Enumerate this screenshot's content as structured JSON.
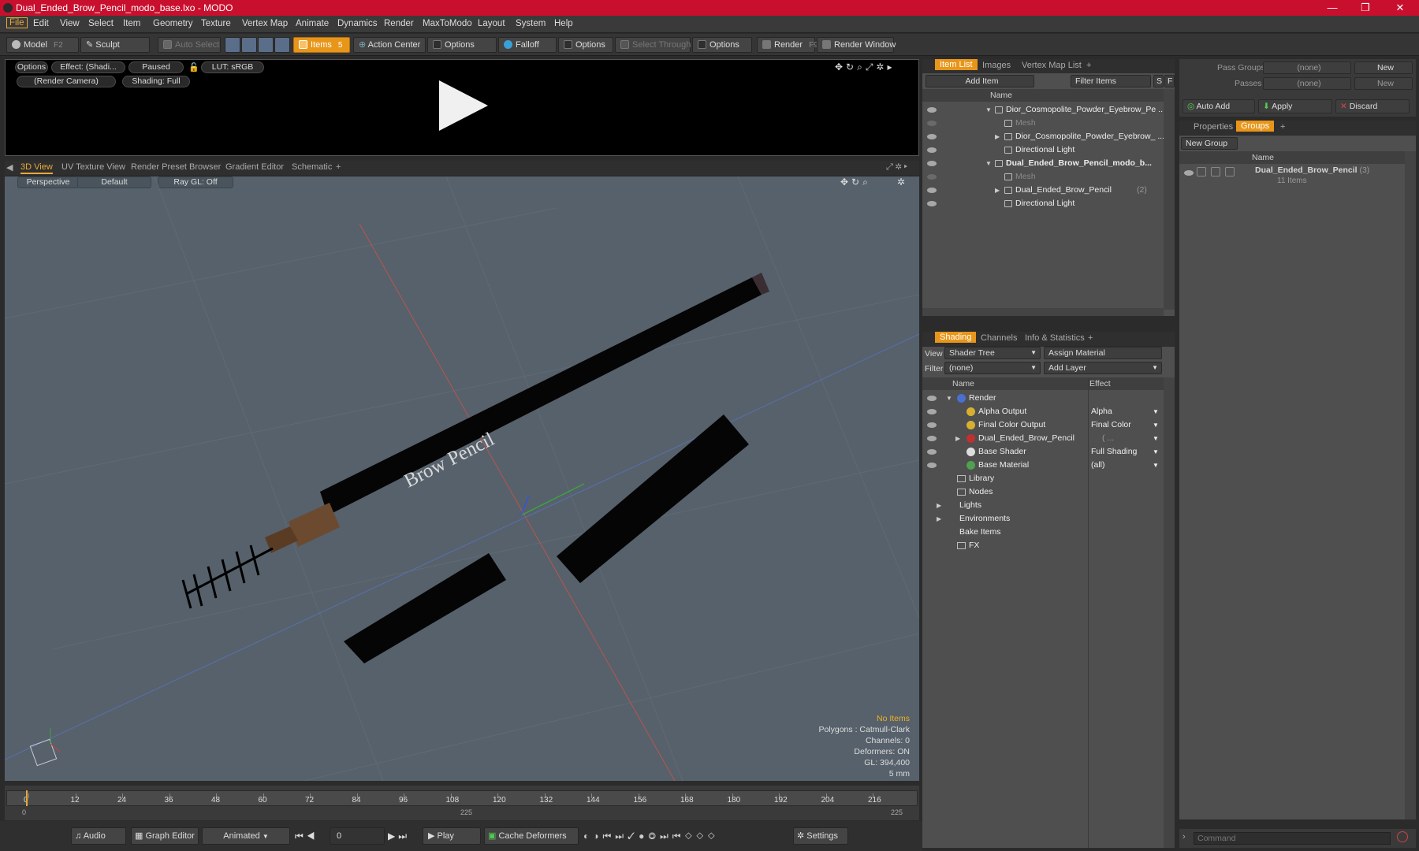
{
  "window": {
    "title": "Dual_Ended_Brow_Pencil_modo_base.lxo - MODO"
  },
  "menu": [
    "File",
    "Edit",
    "View",
    "Select",
    "Item",
    "Geometry",
    "Texture",
    "Vertex Map",
    "Animate",
    "Dynamics",
    "Render",
    "MaxToModo",
    "Layout",
    "System",
    "Help"
  ],
  "toolbar": {
    "model": "Model",
    "model_key": "F2",
    "sculpt": "Sculpt",
    "auto_select": "Auto Select",
    "items": "Items",
    "items_key": "5",
    "action_center": "Action Center",
    "options1": "Options",
    "falloff": "Falloff",
    "options2": "Options",
    "select_through": "Select Through",
    "options3": "Options",
    "render": "Render",
    "render_key": "F9",
    "render_window": "Render Window"
  },
  "preview": {
    "options": "Options",
    "effect": "Effect: (Shadi...",
    "paused": "Paused",
    "lut": "LUT: sRGB",
    "camera": "(Render Camera)",
    "shading": "Shading: Full"
  },
  "view_tabs": [
    "3D View",
    "UV Texture View",
    "Render Preset Browser",
    "Gradient Editor",
    "Schematic",
    "+"
  ],
  "viewport": {
    "perspective": "Perspective",
    "default": "Default",
    "raygl": "Ray GL: Off",
    "label_text": "Brow Pencil",
    "hud": {
      "no_items": "No Items",
      "polygons": "Polygons : Catmull-Clark",
      "channels": "Channels: 0",
      "deformers": "Deformers: ON",
      "gl": "GL: 394,400",
      "scale": "5 mm"
    }
  },
  "timeline": {
    "ticks": [
      "0",
      "12",
      "24",
      "36",
      "48",
      "60",
      "72",
      "84",
      "96",
      "108",
      "120",
      "132",
      "144",
      "156",
      "168",
      "180",
      "192",
      "204",
      "216"
    ],
    "start": "0",
    "mid": "225",
    "end": "225"
  },
  "bottombar": {
    "audio": "Audio",
    "graph_editor": "Graph Editor",
    "animated": "Animated",
    "frame": "0",
    "play": "Play",
    "cache_deformers": "Cache Deformers",
    "settings": "Settings"
  },
  "item_list": {
    "tabs": [
      "Item List",
      "Images",
      "Vertex Map List",
      "+"
    ],
    "add_item": "Add Item",
    "filter_items": "Filter Items",
    "s": "S",
    "f": "F",
    "col_name": "Name",
    "rows": [
      {
        "label": "Dior_Cosmopolite_Powder_Eyebrow_Pe ...",
        "indent": 0,
        "arrow": "▼",
        "type": "scene"
      },
      {
        "label": "Mesh",
        "indent": 1,
        "arrow": "",
        "type": "mesh",
        "dim": true
      },
      {
        "label": "Dior_Cosmopolite_Powder_Eyebrow_ ...",
        "indent": 1,
        "arrow": "▶",
        "type": "group"
      },
      {
        "label": "Directional Light",
        "indent": 1,
        "arrow": "",
        "type": "light"
      },
      {
        "label": "Dual_Ended_Brow_Pencil_modo_b...",
        "indent": 0,
        "arrow": "▼",
        "type": "scene",
        "bold": true
      },
      {
        "label": "Mesh",
        "indent": 1,
        "arrow": "",
        "type": "mesh",
        "dim": true
      },
      {
        "label": "Dual_Ended_Brow_Pencil",
        "count": "(2)",
        "indent": 1,
        "arrow": "▶",
        "type": "group"
      },
      {
        "label": "Directional Light",
        "indent": 1,
        "arrow": "",
        "type": "light"
      }
    ]
  },
  "shading": {
    "tabs": [
      "Shading",
      "Channels",
      "Info & Statistics",
      "+"
    ],
    "view_label": "View",
    "view_value": "Shader Tree",
    "assign_material": "Assign Material",
    "filter_label": "Filter",
    "filter_value": "(none)",
    "add_layer": "Add Layer",
    "col_name": "Name",
    "col_effect": "Effect",
    "rows": [
      {
        "label": "Render",
        "effect": "",
        "indent": 0,
        "arrow": "▼",
        "color": "#4a6fd0",
        "eye": true
      },
      {
        "label": "Alpha Output",
        "effect": "Alpha",
        "indent": 1,
        "arrow": "",
        "color": "#d8b030",
        "eye": true
      },
      {
        "label": "Final Color Output",
        "effect": "Final Color",
        "indent": 1,
        "arrow": "",
        "color": "#d8b030",
        "eye": true
      },
      {
        "label": "Dual_Ended_Brow_Pencil",
        "count": "( ...",
        "effect": "",
        "indent": 1,
        "arrow": "▶",
        "color": "#c03030",
        "eye": true
      },
      {
        "label": "Base Shader",
        "effect": "Full Shading",
        "indent": 1,
        "arrow": "",
        "color": "#dddddd",
        "eye": true
      },
      {
        "label": "Base Material",
        "effect": "(all)",
        "indent": 1,
        "arrow": "",
        "color": "#50a050",
        "eye": true
      },
      {
        "label": "Library",
        "effect": "",
        "indent": 0,
        "arrow": "",
        "color": "",
        "eye": false,
        "folder": true
      },
      {
        "label": "Nodes",
        "effect": "",
        "indent": 0,
        "arrow": "",
        "color": "",
        "eye": false,
        "folder": true
      },
      {
        "label": "Lights",
        "effect": "",
        "indent": -1,
        "arrow": "▶",
        "color": "",
        "eye": false
      },
      {
        "label": "Environments",
        "effect": "",
        "indent": -1,
        "arrow": "▶",
        "color": "",
        "eye": false
      },
      {
        "label": "Bake Items",
        "effect": "",
        "indent": -1,
        "arrow": "",
        "color": "",
        "eye": false
      },
      {
        "label": "FX",
        "effect": "",
        "indent": 0,
        "arrow": "",
        "color": "",
        "eye": false,
        "fx": true
      }
    ]
  },
  "groups": {
    "pass_groups_label": "Pass Groups",
    "pass_groups_value": "(none)",
    "new": "New",
    "passes_label": "Passes",
    "passes_value": "(none)",
    "new2": "New",
    "auto_add": "Auto Add",
    "apply": "Apply",
    "discard": "Discard",
    "tabs": [
      "Properties",
      "Groups",
      "+"
    ],
    "new_group": "New Group",
    "col_name": "Name",
    "group_name": "Dual_Ended_Brow_Pencil",
    "group_count": "(3)",
    "group_items": "11 Items"
  },
  "command": {
    "placeholder": "Command"
  }
}
